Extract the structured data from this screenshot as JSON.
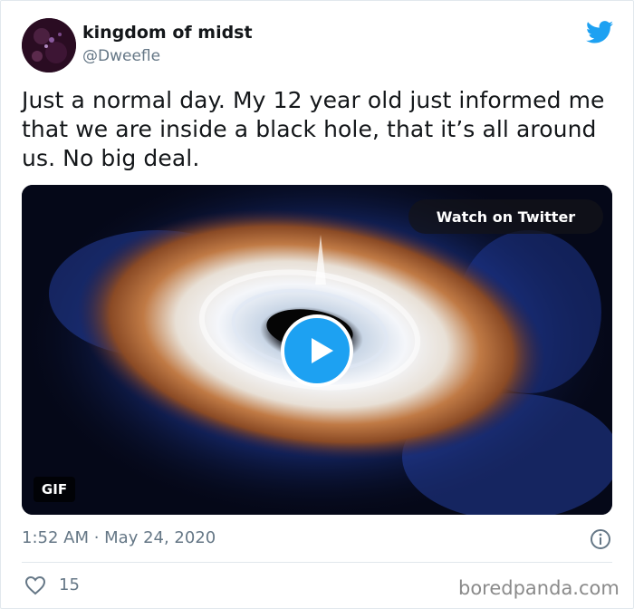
{
  "user": {
    "display_name": "kingdom of midst",
    "handle": "@Dweefle"
  },
  "tweet": {
    "text": "Just a normal day. My 12 year old just informed me that we are inside a black hole, that it’s all around us. No big deal.",
    "timestamp": "1:52 AM · May 24, 2020",
    "like_count": "15"
  },
  "media": {
    "watch_label": "Watch on Twitter",
    "badge": "GIF"
  },
  "icons": {
    "brand": "twitter-bird-icon",
    "play": "play-icon",
    "info": "info-icon",
    "like": "heart-icon"
  },
  "colors": {
    "twitter_blue": "#1da1f2",
    "secondary_text": "#657786"
  },
  "watermark": "boredpanda.com"
}
